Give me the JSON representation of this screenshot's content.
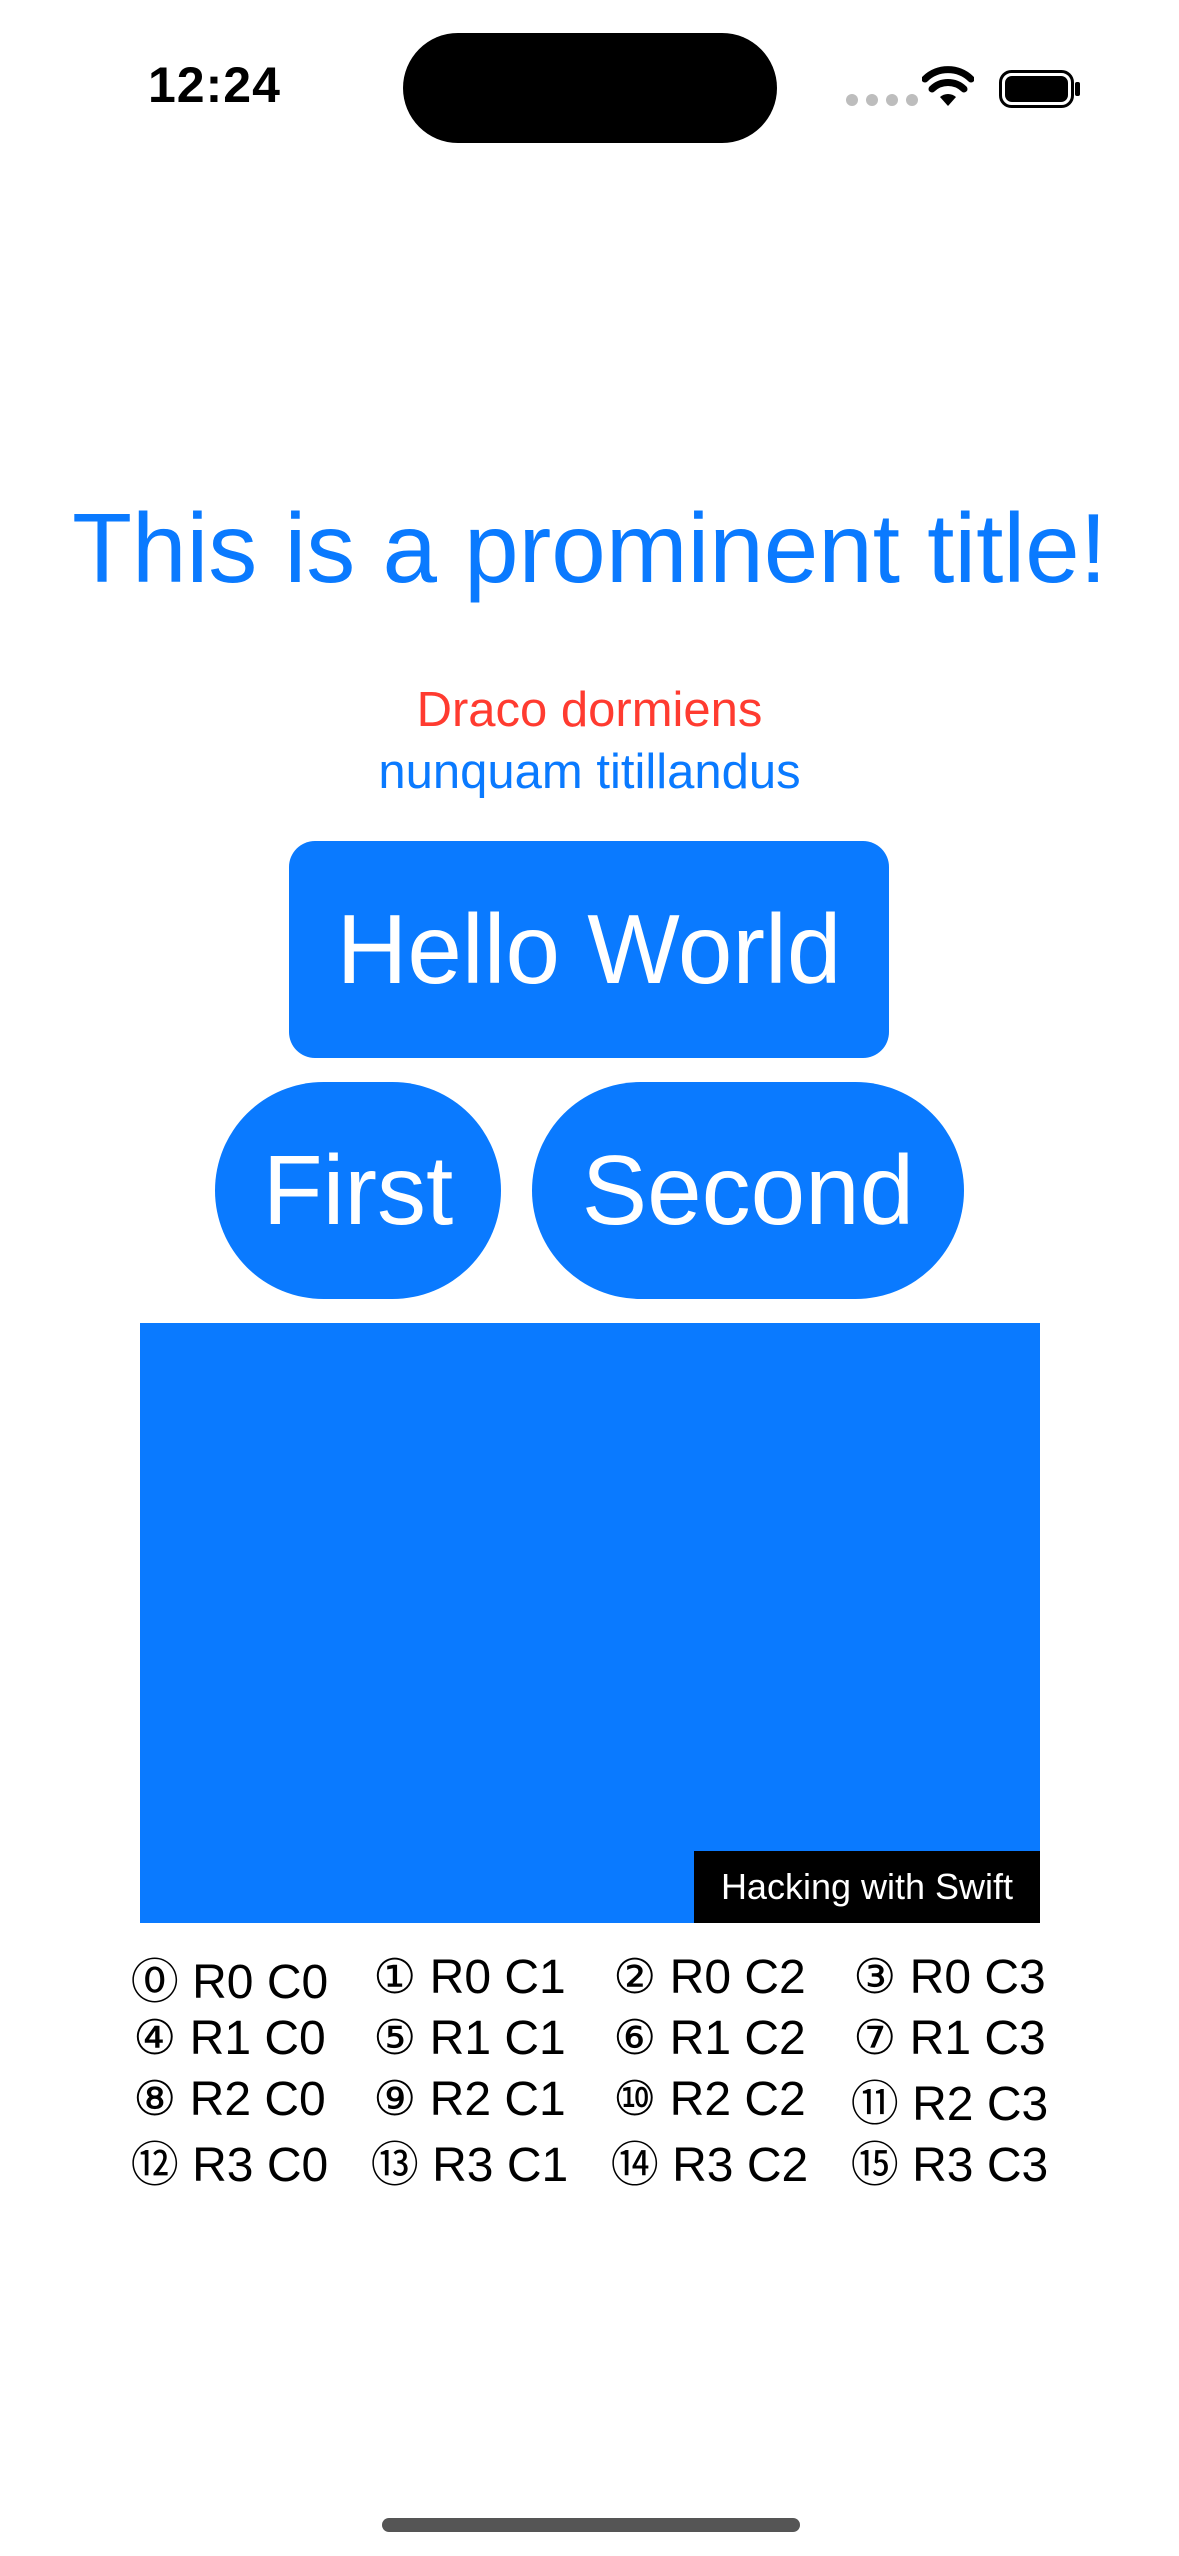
{
  "status_bar": {
    "time": "12:24",
    "icons": [
      "signal-dots-icon",
      "wifi-icon",
      "battery-icon"
    ]
  },
  "main": {
    "title": "This is a prominent title!",
    "subtitle_line1": "Draco dormiens",
    "subtitle_line2": "nunquam titillandus",
    "hello_button_label": "Hello World",
    "first_button_label": "First",
    "second_button_label": "Second",
    "watermark_label": "Hacking with Swift"
  },
  "grid": {
    "rows": [
      [
        "⓪ R0 C0",
        "① R0 C1",
        "② R0 C2",
        "③ R0 C3"
      ],
      [
        "④ R1 C0",
        "⑤ R1 C1",
        "⑥ R1 C2",
        "⑦ R1 C3"
      ],
      [
        "⑧ R2 C0",
        "⑨ R2 C1",
        "⑩ R2 C2",
        "⑪ R2 C3"
      ],
      [
        "⑫ R3 C0",
        "⑬ R3 C1",
        "⑭ R3 C2",
        "⑮ R3 C3"
      ]
    ]
  },
  "colors": {
    "accent": "#0a7aff",
    "subtitle_red": "#ff3b30"
  }
}
